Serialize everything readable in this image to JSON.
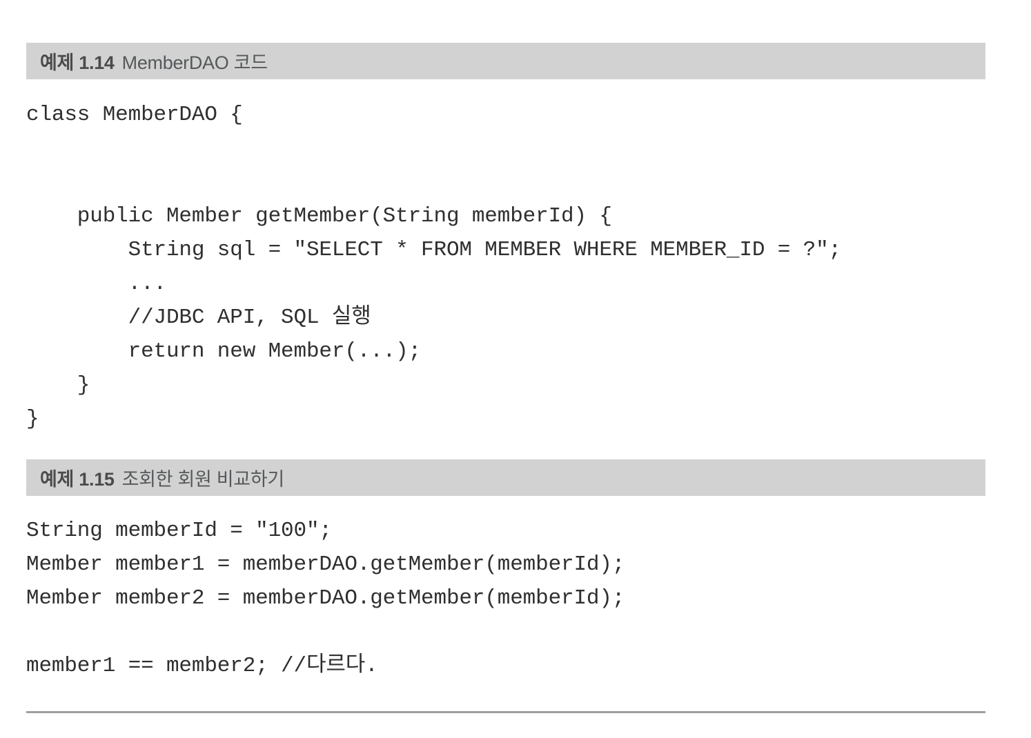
{
  "page": {
    "background_color": "#ffffff",
    "caption_bar_color": "#d2d2d2",
    "rule_color": "#9e9e9e",
    "code_text_color": "#2f2f2f",
    "caption_text_color": "#4b4b4b"
  },
  "listings": [
    {
      "caption": {
        "number": "예제 1.14",
        "title": "MemberDAO 코드"
      },
      "code_lines": [
        "class MemberDAO {",
        "",
        "",
        "    public Member getMember(String memberId) {",
        "        String sql = \"SELECT * FROM MEMBER WHERE MEMBER_ID = ?\";",
        "        ...",
        "        //JDBC API, SQL 실행",
        "        return new Member(...);",
        "    }",
        "}"
      ]
    },
    {
      "caption": {
        "number": "예제 1.15",
        "title": "조회한 회원 비교하기"
      },
      "code_lines": [
        "String memberId = \"100\";",
        "Member member1 = memberDAO.getMember(memberId);",
        "Member member2 = memberDAO.getMember(memberId);",
        "",
        "member1 == member2; //다르다."
      ]
    }
  ]
}
